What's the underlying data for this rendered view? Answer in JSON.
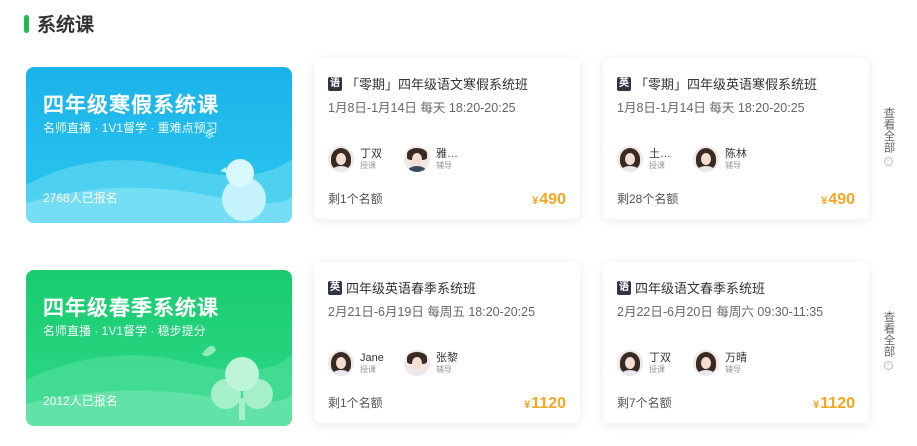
{
  "section": {
    "title": "系统课"
  },
  "rows": [
    {
      "promo": {
        "title": "四年级寒假系统课",
        "subtitle": "名师直播 · 1V1督学 · 重难点预习",
        "count": "2768人已报名",
        "theme": "#1fb6e8"
      },
      "cards": [
        {
          "subject": "语",
          "title": "「零期」四年级语文寒假系统班",
          "time": "1月8日-1月14日 每天 18:20-20:25",
          "teachers": [
            {
              "name": "丁双",
              "role": "授课"
            },
            {
              "name": "雅…",
              "role": "辅导"
            }
          ],
          "remaining": "剩1个名额",
          "price": "490"
        },
        {
          "subject": "英",
          "title": "「零期」四年级英语寒假系统班",
          "time": "1月8日-1月14日 每天 18:20-20:25",
          "teachers": [
            {
              "name": "土…",
              "role": "授课"
            },
            {
              "name": "陈林",
              "role": "辅导"
            }
          ],
          "remaining": "剩28个名额",
          "price": "490"
        }
      ],
      "view_all": "查看全部"
    },
    {
      "promo": {
        "title": "四年级春季系统课",
        "subtitle": "名师直播 · 1V1督学 · 稳步提分",
        "count": "2012人已报名",
        "theme": "#1dcb7b"
      },
      "cards": [
        {
          "subject": "英",
          "title": "四年级英语春季系统班",
          "time": "2月21日-6月19日 每周五 18:20-20:25",
          "teachers": [
            {
              "name": "Jane",
              "role": "授课"
            },
            {
              "name": "张黎",
              "role": "辅导"
            }
          ],
          "remaining": "剩1个名额",
          "price": "1120"
        },
        {
          "subject": "语",
          "title": "四年级语文春季系统班",
          "time": "2月22日-6月20日 每周六 09:30-11:35",
          "teachers": [
            {
              "name": "丁双",
              "role": "授课"
            },
            {
              "name": "万晴",
              "role": "辅导"
            }
          ],
          "remaining": "剩7个名额",
          "price": "1120"
        }
      ],
      "view_all": "查看全部"
    }
  ],
  "currency": "¥"
}
